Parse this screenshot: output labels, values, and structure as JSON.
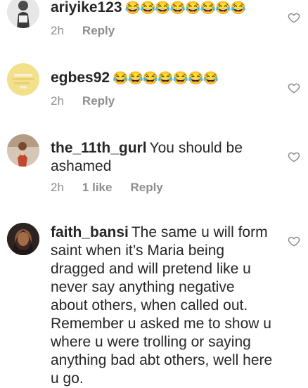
{
  "comments": [
    {
      "username": "ariyike123",
      "text": "",
      "emoji": "😂😂😂😂😂😂😂😂",
      "time": "2h",
      "likes": "",
      "reply": "Reply"
    },
    {
      "username": "egbes92",
      "text": "",
      "emoji": "😂😂😂😂😂😂😂",
      "time": "2h",
      "likes": "",
      "reply": "Reply"
    },
    {
      "username": "the_11th_gurl",
      "text": "You should be ashamed",
      "emoji": "",
      "time": "2h",
      "likes": "1 like",
      "reply": "Reply"
    },
    {
      "username": "faith_bansi",
      "text": "The same u will form saint when it’s Maria being dragged and will pretend like u never say anything negative about others, when called out. Remember u asked me to show u where u were trolling or saying anything bad abt others, well here u go.",
      "emoji": "",
      "time": "",
      "likes": "",
      "reply": ""
    }
  ],
  "icons": {
    "like": "heart-outline-icon"
  },
  "colors": {
    "text": "#262626",
    "meta": "#8e8e8e",
    "heart": "#8e8e8e"
  }
}
